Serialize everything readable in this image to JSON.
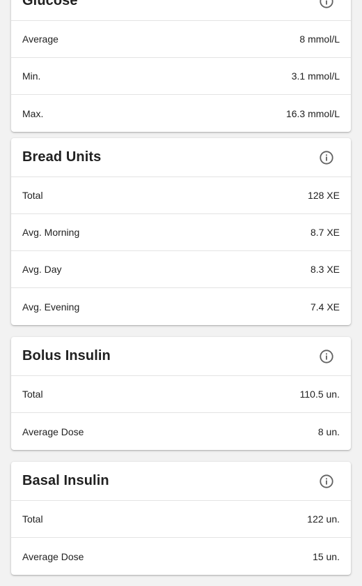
{
  "glucose": {
    "title": "Glucose",
    "rows": [
      {
        "label": "Average",
        "value": "8 mmol/L"
      },
      {
        "label": "Min.",
        "value": "3.1 mmol/L"
      },
      {
        "label": "Max.",
        "value": "16.3 mmol/L"
      }
    ]
  },
  "bread_units": {
    "title": "Bread Units",
    "rows": [
      {
        "label": "Total",
        "value": "128 XE"
      },
      {
        "label": "Avg. Morning",
        "value": "8.7 XE"
      },
      {
        "label": "Avg. Day",
        "value": "8.3 XE"
      },
      {
        "label": "Avg. Evening",
        "value": "7.4 XE"
      }
    ]
  },
  "bolus_insulin": {
    "title": "Bolus Insulin",
    "rows": [
      {
        "label": "Total",
        "value": "110.5 un."
      },
      {
        "label": "Average Dose",
        "value": "8 un."
      }
    ]
  },
  "basal_insulin": {
    "title": "Basal Insulin",
    "rows": [
      {
        "label": "Total",
        "value": "122 un."
      },
      {
        "label": "Average Dose",
        "value": "15 un."
      }
    ]
  },
  "icons": {
    "info": "info-icon"
  },
  "colors": {
    "background": "#f2f2f2",
    "card": "#ffffff",
    "text": "#212121",
    "icon": "#616161",
    "divider": "#e3e3e3"
  }
}
